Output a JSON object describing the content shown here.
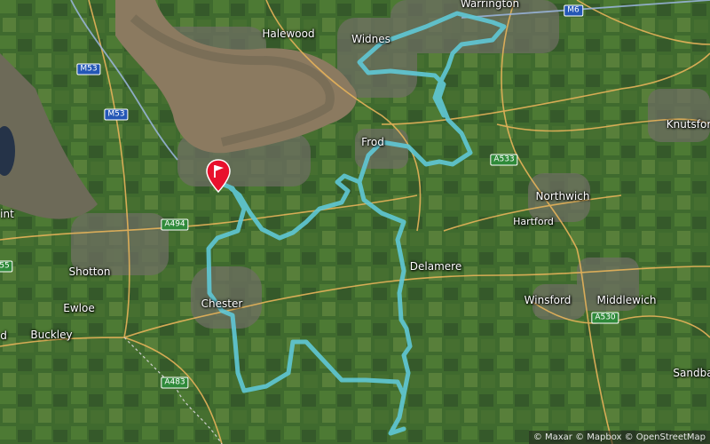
{
  "map": {
    "places": [
      {
        "id": "warrington",
        "label": "Warrington"
      },
      {
        "id": "halewood",
        "label": "Halewood"
      },
      {
        "id": "widnes",
        "label": "Widnes"
      },
      {
        "id": "frodsham",
        "label": "Frod"
      },
      {
        "id": "knutsford",
        "label": "Knutsfor"
      },
      {
        "id": "northwich",
        "label": "Northwich"
      },
      {
        "id": "hartford",
        "label": "Hartford"
      },
      {
        "id": "delamere",
        "label": "Delamere"
      },
      {
        "id": "shotton",
        "label": "Shotton"
      },
      {
        "id": "ewloe",
        "label": "Ewloe"
      },
      {
        "id": "buckley",
        "label": "Buckley"
      },
      {
        "id": "chester",
        "label": "Chester"
      },
      {
        "id": "winsford",
        "label": "Winsford"
      },
      {
        "id": "middlewich",
        "label": "Middlewich"
      },
      {
        "id": "sandbach",
        "label": "Sandba"
      },
      {
        "id": "flint",
        "label": "int"
      },
      {
        "id": "mold",
        "label": "d"
      }
    ],
    "roads": [
      {
        "id": "m53a",
        "label": "M53",
        "type": "motorway"
      },
      {
        "id": "m53b",
        "label": "M53",
        "type": "motorway"
      },
      {
        "id": "m6",
        "label": "M6",
        "type": "motorway"
      },
      {
        "id": "a533",
        "label": "A533",
        "type": "primary"
      },
      {
        "id": "a494",
        "label": "A494",
        "type": "primary"
      },
      {
        "id": "a530",
        "label": "A530",
        "type": "primary"
      },
      {
        "id": "a483",
        "label": "A483",
        "type": "primary"
      },
      {
        "id": "a55",
        "label": "55",
        "type": "primary"
      }
    ],
    "route_color": "#5fc8d6",
    "marker_color": "#e8112d",
    "attribution": "© Maxar © Mapbox © OpenStreetMap"
  }
}
